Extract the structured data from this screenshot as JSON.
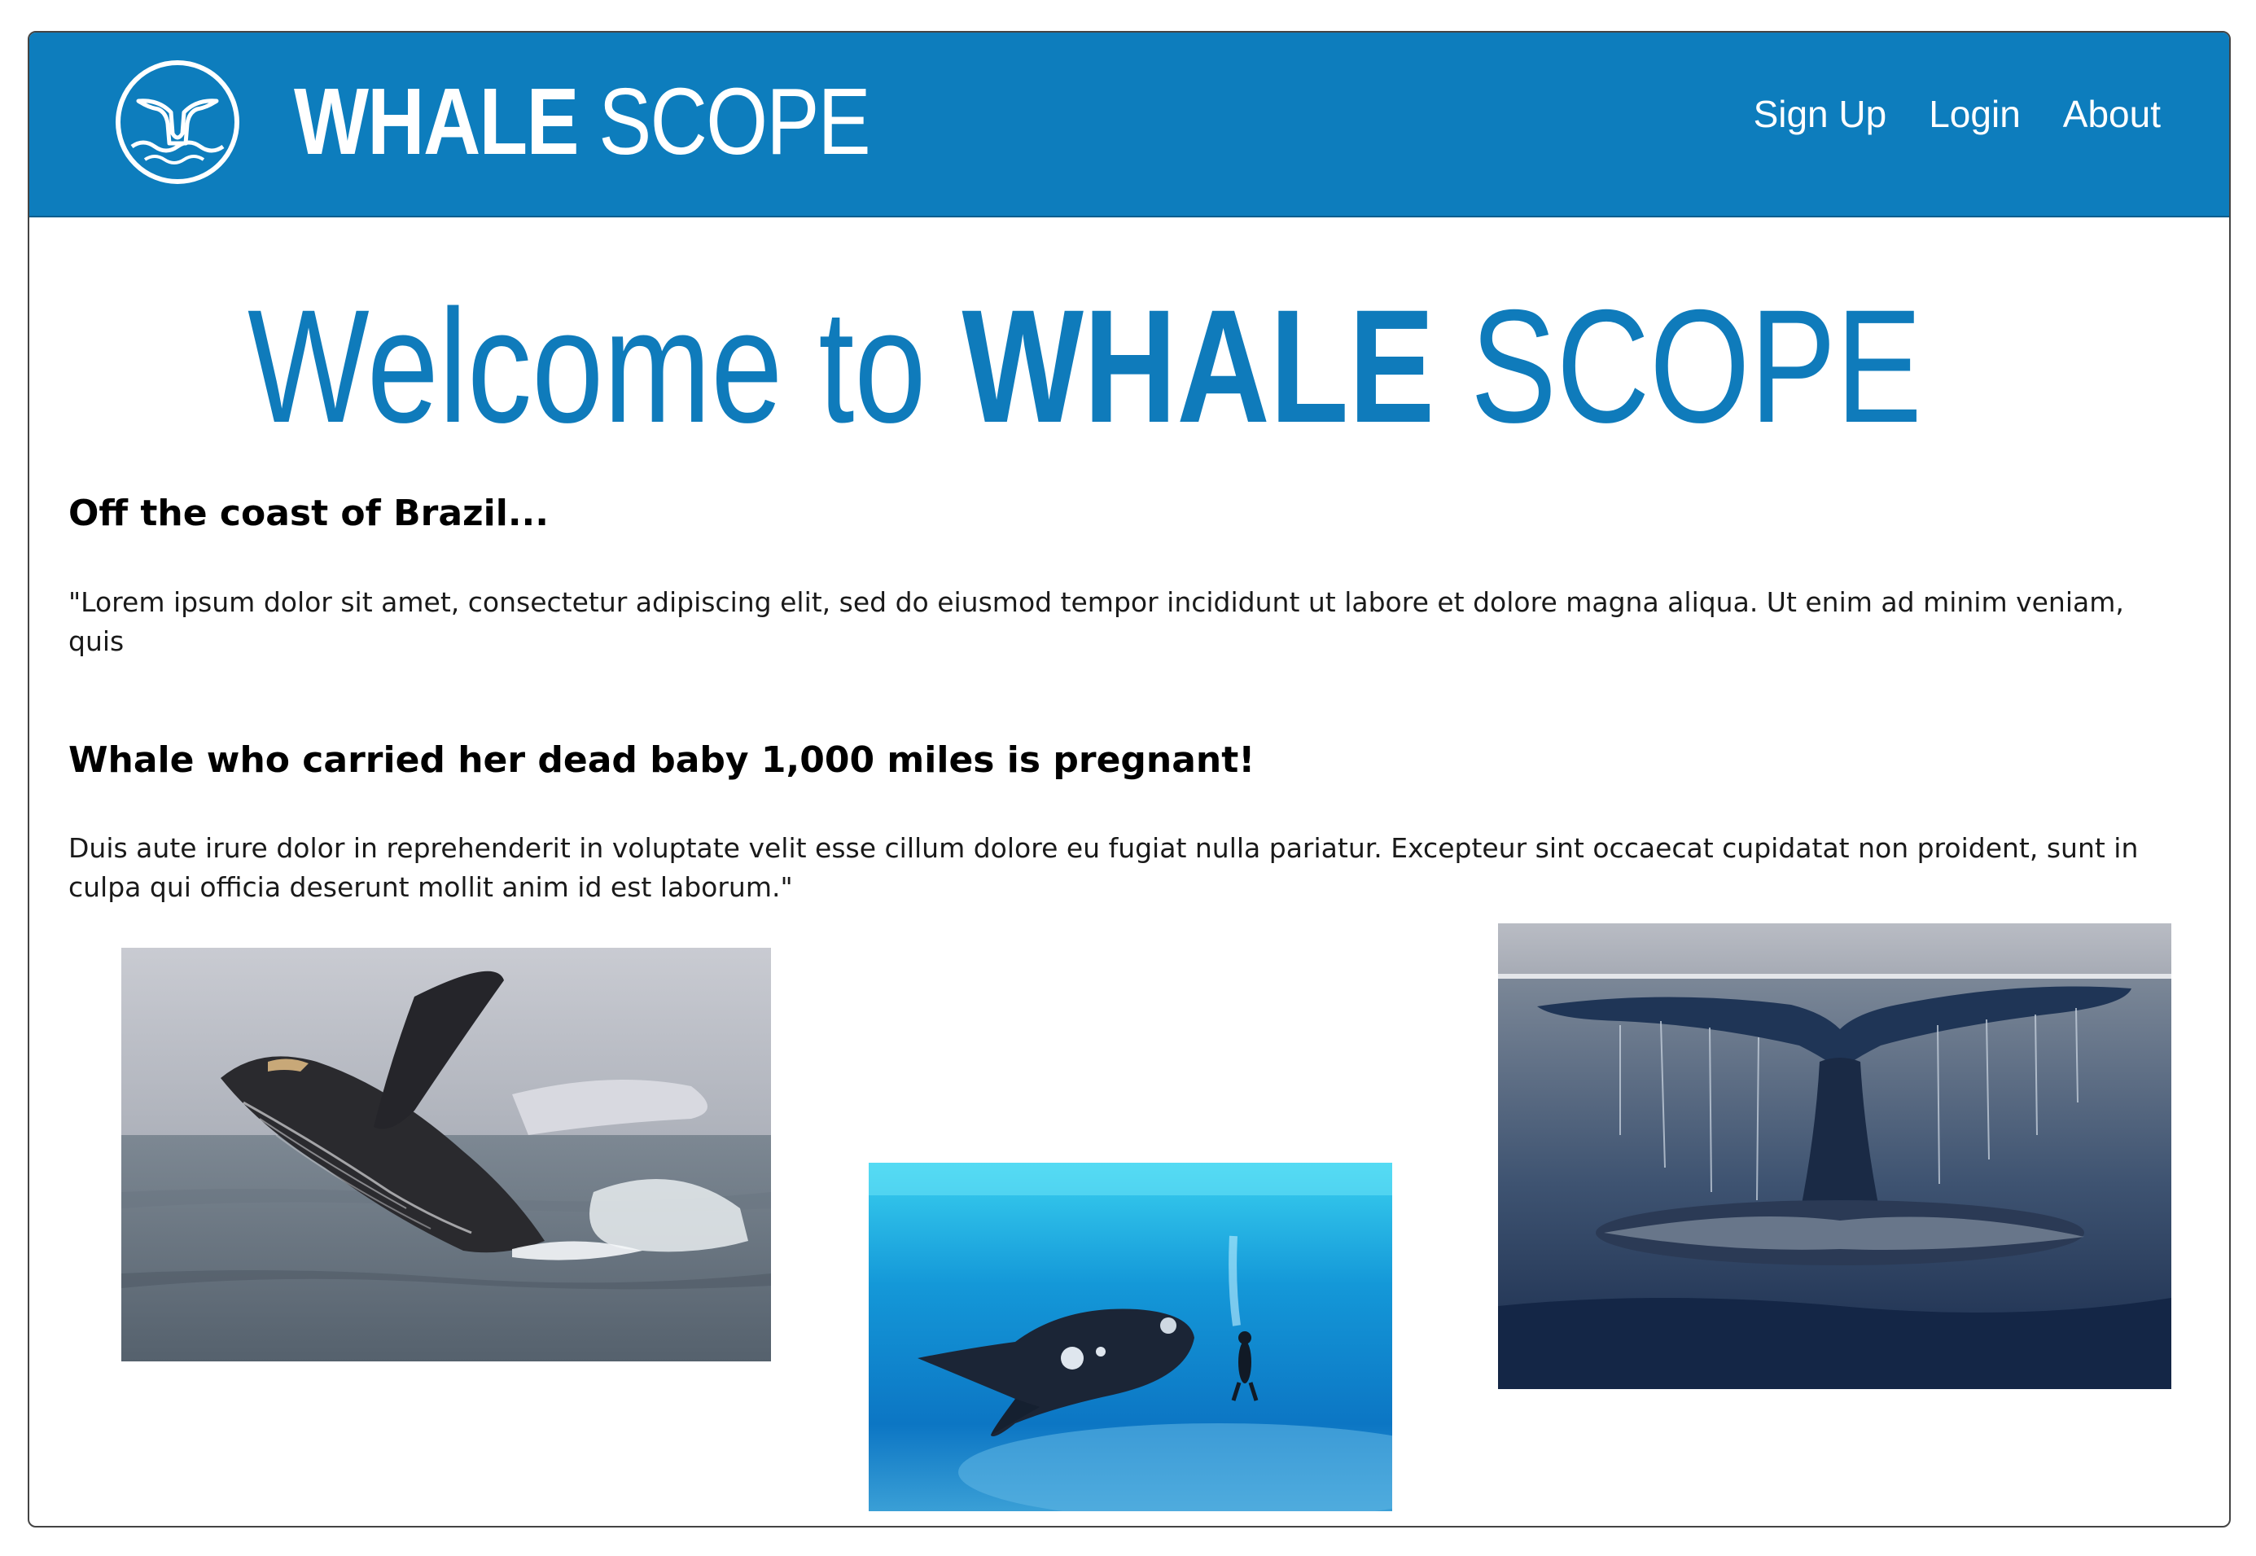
{
  "header": {
    "brand_bold": "WHALE",
    "brand_light": "SCOPE",
    "nav": [
      {
        "label": "Sign Up"
      },
      {
        "label": "Login"
      },
      {
        "label": "About"
      }
    ],
    "logo_icon": "whale-tail-icon"
  },
  "hero": {
    "prefix": "Welcome to ",
    "brand_bold": "WHALE",
    "brand_light": " SCOPE"
  },
  "articles": [
    {
      "title": "Off the coast of Brazil...",
      "body": "\"Lorem ipsum dolor sit amet, consectetur adipiscing elit, sed do eiusmod tempor incididunt ut labore et dolore magna aliqua. Ut enim ad minim veniam, quis"
    },
    {
      "title": "Whale who carried her dead baby 1,000 miles is pregnant!",
      "body": "Duis aute irure dolor in reprehenderit in voluptate velit esse cillum dolore eu fugiat nulla pariatur. Excepteur sint occaecat cupidatat non proident, sunt in culpa qui officia deserunt mollit anim id est laborum.\""
    }
  ],
  "colors": {
    "header_bg": "#0d7dbd",
    "accent": "#0f7bbb"
  },
  "photos": [
    {
      "subject": "breaching humpback whale"
    },
    {
      "subject": "right whale with diver underwater"
    },
    {
      "subject": "whale tail fluke above water"
    }
  ]
}
